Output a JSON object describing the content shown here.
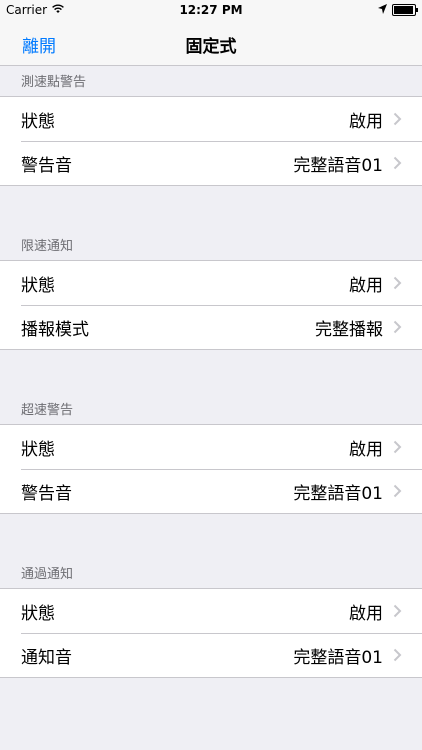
{
  "statusbar": {
    "carrier": "Carrier",
    "time": "12:27 PM"
  },
  "nav": {
    "back_label": "離開",
    "title": "固定式"
  },
  "sections": [
    {
      "header": "測速點警告",
      "rows": [
        {
          "label": "狀態",
          "value": "啟用"
        },
        {
          "label": "警告音",
          "value": "完整語音01"
        }
      ]
    },
    {
      "header": "限速通知",
      "rows": [
        {
          "label": "狀態",
          "value": "啟用"
        },
        {
          "label": "播報模式",
          "value": "完整播報"
        }
      ]
    },
    {
      "header": "超速警告",
      "rows": [
        {
          "label": "狀態",
          "value": "啟用"
        },
        {
          "label": "警告音",
          "value": "完整語音01"
        }
      ]
    },
    {
      "header": "通過通知",
      "rows": [
        {
          "label": "狀態",
          "value": "啟用"
        },
        {
          "label": "通知音",
          "value": "完整語音01"
        }
      ]
    }
  ],
  "colors": {
    "accent": "#007aff",
    "background": "#efeff4",
    "section_header_text": "#6d6d72",
    "chevron": "#c7c7cc"
  },
  "icons": [
    "wifi-icon",
    "location-icon",
    "battery-icon",
    "chevron-right-icon"
  ]
}
